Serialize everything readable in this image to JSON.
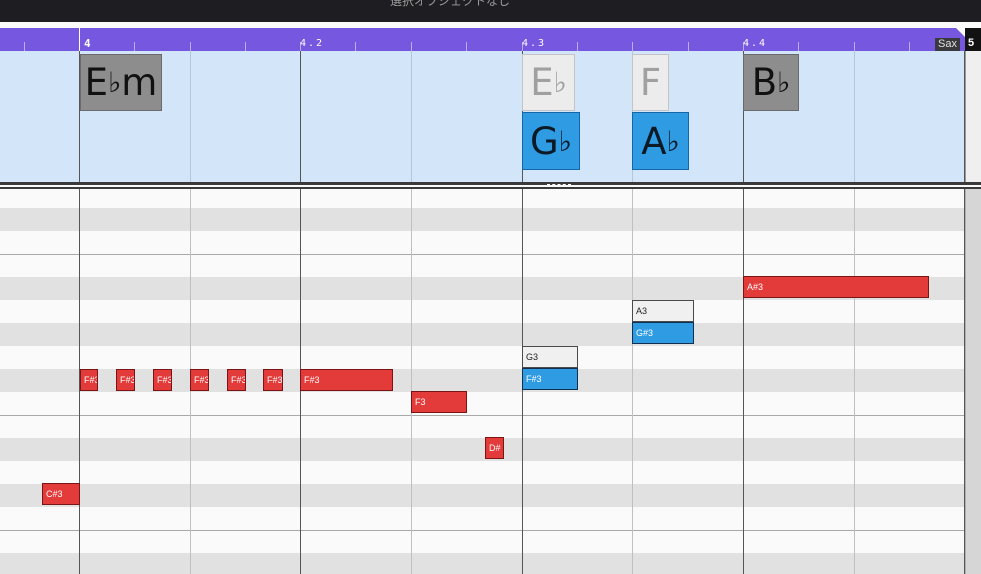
{
  "header": {
    "title": "選択オブジェクトなし"
  },
  "ruler": {
    "bar_start": "4",
    "beat_2": "4.2",
    "beat_3": "4.3",
    "beat_4": "4.4",
    "bar_end": "5",
    "track_tag": "Sax"
  },
  "chord_track": {
    "chords": [
      {
        "root": "E",
        "accidental": "♭",
        "quality": "m",
        "style": "selected"
      },
      {
        "root": "E",
        "accidental": "♭",
        "quality": "",
        "style": "ghost"
      },
      {
        "root": "G",
        "accidental": "♭",
        "quality": "",
        "style": "scale"
      },
      {
        "root": "F",
        "accidental": "",
        "quality": "",
        "style": "ghost"
      },
      {
        "root": "A",
        "accidental": "♭",
        "quality": "",
        "style": "scale"
      },
      {
        "root": "B",
        "accidental": "♭",
        "quality": "",
        "style": "selected"
      }
    ]
  },
  "piano_roll": {
    "notes": [
      {
        "label": "C#3",
        "color": "red"
      },
      {
        "label": "F#3",
        "color": "red"
      },
      {
        "label": "F#3",
        "color": "red"
      },
      {
        "label": "F#3",
        "color": "red"
      },
      {
        "label": "F#3",
        "color": "red"
      },
      {
        "label": "F#3",
        "color": "red"
      },
      {
        "label": "F#3",
        "color": "red"
      },
      {
        "label": "F#3",
        "color": "red"
      },
      {
        "label": "F3",
        "color": "red"
      },
      {
        "label": "D#",
        "color": "red"
      },
      {
        "label": "G3",
        "color": "white"
      },
      {
        "label": "F#3",
        "color": "blue"
      },
      {
        "label": "A3",
        "color": "white"
      },
      {
        "label": "G#3",
        "color": "blue"
      },
      {
        "label": "A#3",
        "color": "red"
      }
    ]
  },
  "colors": {
    "ruler": "#7557e0",
    "chord_lane": "#d3e6f9",
    "chord_selected": "#8d8d8d",
    "chord_scale": "#2e9be3",
    "note_red": "#e33a3a",
    "note_blue": "#2e9be3"
  }
}
